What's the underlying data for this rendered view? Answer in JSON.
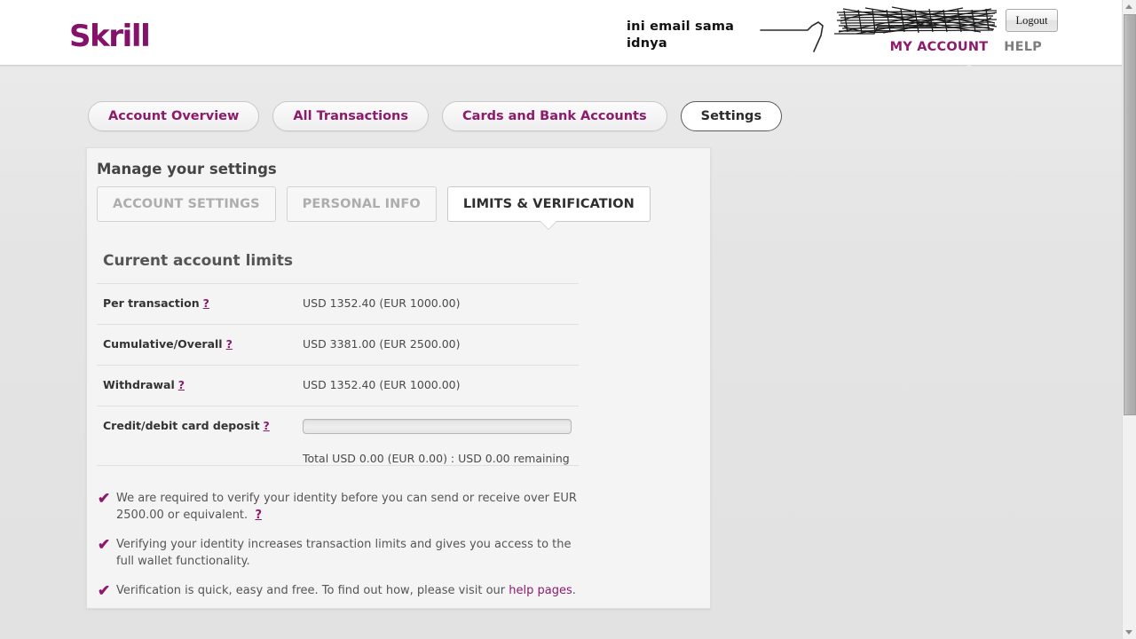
{
  "header": {
    "logo_text": "Skrill",
    "handwritten_note": "ini email sama idnya",
    "logout_label": "Logout",
    "nav": [
      {
        "label": "MY ACCOUNT",
        "active": true
      },
      {
        "label": "HELP",
        "active": false
      }
    ],
    "accent_color": "#8e1a6b",
    "logo_color": "#86116a"
  },
  "tabs": [
    {
      "label": "Account Overview",
      "active": false
    },
    {
      "label": "All Transactions",
      "active": false
    },
    {
      "label": "Cards and Bank Accounts",
      "active": false
    },
    {
      "label": "Settings",
      "active": true
    }
  ],
  "panel": {
    "title": "Manage your settings",
    "subtabs": [
      {
        "label": "ACCOUNT SETTINGS",
        "active": false
      },
      {
        "label": "PERSONAL INFO",
        "active": false
      },
      {
        "label": "LIMITS & VERIFICATION",
        "active": true
      }
    ],
    "section_title": "Current account limits",
    "help_marker": "?",
    "limits": [
      {
        "label": "Per transaction",
        "value": "USD 1352.40 (EUR 1000.00)"
      },
      {
        "label": "Cumulative/Overall",
        "value": "USD 3381.00 (EUR 2500.00)"
      },
      {
        "label": "Withdrawal",
        "value": "USD 1352.40 (EUR 1000.00)"
      }
    ],
    "deposit": {
      "label": "Credit/debit card deposit",
      "progress_percent": 0,
      "caption": "Total USD 0.00 (EUR 0.00) : USD 0.00 remaining"
    },
    "notes": [
      {
        "check": "✔",
        "text": "We are required to verify your identity before you can send or receive over EUR 2500.00 or equivalent.",
        "has_help_marker": true,
        "link_text": "",
        "tail_text": ""
      },
      {
        "check": "✔",
        "text": "Verifying your identity increases transaction limits and gives you access to the full wallet functionality.",
        "has_help_marker": false,
        "link_text": "",
        "tail_text": ""
      },
      {
        "check": "✔",
        "text": "Verification is quick, easy and free. To find out how, please visit our ",
        "has_help_marker": false,
        "link_text": "help pages",
        "tail_text": "."
      }
    ]
  },
  "scrollbar": {
    "up_arrow": "▲",
    "down_arrow": "▼"
  }
}
